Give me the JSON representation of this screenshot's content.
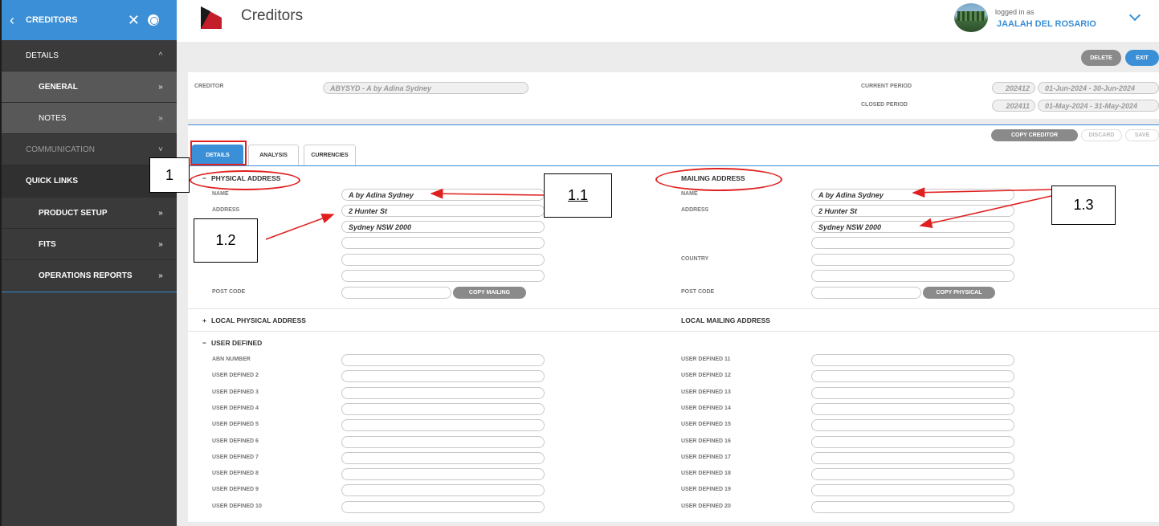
{
  "sidebar": {
    "title": "CREDITORS",
    "items": [
      {
        "label": "DETAILS",
        "arrow": "^"
      },
      {
        "label": "GENERAL",
        "arrow": "»"
      },
      {
        "label": "NOTES",
        "arrow": "»"
      },
      {
        "label": "COMMUNICATION",
        "arrow": "˅"
      },
      {
        "label": "QUICK LINKS",
        "arrow": ""
      },
      {
        "label": "PRODUCT SETUP",
        "arrow": "»"
      },
      {
        "label": "FITS",
        "arrow": "»"
      },
      {
        "label": "OPERATIONS REPORTS",
        "arrow": "»"
      }
    ]
  },
  "header": {
    "title": "Creditors",
    "logged_in_label": "logged in as",
    "username": "JAALAH DEL ROSARIO"
  },
  "actions": {
    "delete": "DELETE",
    "exit": "EXIT",
    "copy_creditor": "COPY CREDITOR",
    "discard": "DISCARD",
    "save": "SAVE"
  },
  "creditor": {
    "label": "CREDITOR",
    "value": "ABYSYD - A by Adina Sydney",
    "current_period_label": "CURRENT PERIOD",
    "current_period_code": "202412",
    "current_period_range": "01-Jun-2024 - 30-Jun-2024",
    "closed_period_label": "CLOSED PERIOD",
    "closed_period_code": "202411",
    "closed_period_range": "01-May-2024 - 31-May-2024"
  },
  "tabs": [
    "DETAILS",
    "ANALYSIS",
    "CURRENCIES"
  ],
  "physical": {
    "toggle": "−",
    "title": "PHYSICAL ADDRESS",
    "name_label": "NAME",
    "name": "A by Adina Sydney",
    "address_label": "ADDRESS",
    "lines": [
      "2 Hunter St",
      "Sydney  NSW  2000",
      "",
      "",
      ""
    ],
    "postcode_label": "POST CODE",
    "copy_btn": "COPY MAILING"
  },
  "mailing": {
    "title": "MAILING ADDRESS",
    "name_label": "NAME",
    "name": "A by Adina Sydney",
    "address_label": "ADDRESS",
    "lines": [
      "2 Hunter St",
      "Sydney  NSW  2000",
      "",
      "",
      ""
    ],
    "country_label": "COUNTRY",
    "postcode_label": "POST CODE",
    "copy_btn": "COPY PHYSICAL"
  },
  "local": {
    "toggle": "+",
    "physical_title": "LOCAL PHYSICAL ADDRESS",
    "mailing_title": "LOCAL MAILING ADDRESS"
  },
  "user_defined": {
    "toggle": "−",
    "title": "USER DEFINED",
    "left_labels": [
      "ABN NUMBER",
      "USER DEFINED 2",
      "USER DEFINED 3",
      "USER DEFINED 4",
      "USER DEFINED 5",
      "USER DEFINED 6",
      "USER DEFINED 7",
      "USER DEFINED 8",
      "USER DEFINED 9",
      "USER DEFINED 10"
    ],
    "right_labels": [
      "USER DEFINED 11",
      "USER DEFINED 12",
      "USER DEFINED 13",
      "USER DEFINED 14",
      "USER DEFINED 15",
      "USER DEFINED 16",
      "USER DEFINED 17",
      "USER DEFINED 18",
      "USER DEFINED 19",
      "USER DEFINED 20"
    ]
  },
  "annotations": [
    "1",
    "1.1",
    "1.2",
    "1.3"
  ],
  "colors": {
    "accent": "#3b8fd6",
    "sidebar": "#3a3a3a",
    "annotation_red": "#e02020"
  }
}
